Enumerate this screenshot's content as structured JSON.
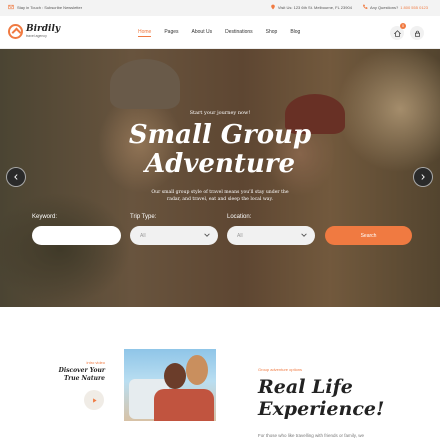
{
  "topbar": {
    "left_text": "Stay in Touch : Subscribe Newsletter",
    "address": "Visit Us: 123 6th St. Melbourne, FL 23904",
    "question_label": "Any Questions?",
    "phone": "1 800 555 0123"
  },
  "header": {
    "logo_name": "Birdily",
    "logo_tag": "travel agency",
    "nav": [
      "Home",
      "Pages",
      "About Us",
      "Destinations",
      "Shop",
      "Blog"
    ],
    "cart_count": "0"
  },
  "hero": {
    "kicker": "Start your journey now!",
    "title_line1": "Small Group",
    "title_line2": "Adventure",
    "desc_line1": "Our small group style of travel means you'll stay under the",
    "desc_line2": "radar, and travel, eat and sleep the local way.",
    "keyword_label": "Keyword:",
    "trip_type_label": "Trip Type:",
    "location_label": "Location:",
    "trip_type_value": "All",
    "location_value": "All",
    "search_label": "Search"
  },
  "about": {
    "video_label": "intro video",
    "video_title_line1": "Discover Your",
    "video_title_line2": "True Nature",
    "kicker": "Group adventure options",
    "title_line1": "Real Life",
    "title_line2": "Experience!",
    "text": "For those who like travelling with friends or family, we"
  },
  "colors": {
    "accent": "#f07a41",
    "topbar_bg": "#f3f3f3"
  },
  "icons": [
    "logo-bird-icon",
    "mail-icon",
    "location-pin-icon",
    "phone-icon",
    "home-icon",
    "lock-icon",
    "chevron-left-icon",
    "chevron-right-icon",
    "chevron-down-icon",
    "play-icon"
  ]
}
